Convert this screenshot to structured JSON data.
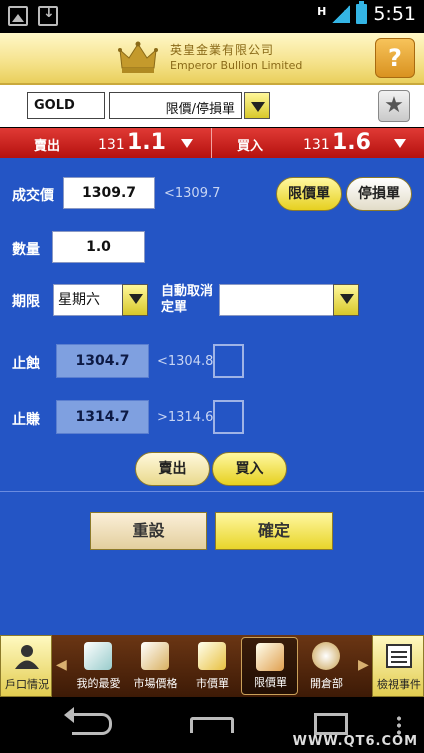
{
  "status_bar": {
    "network": "H",
    "time": "5:51"
  },
  "header": {
    "brand_cn": "英皇金業有限公司",
    "brand_en": "Emperor Bullion Limited",
    "help_label": "?"
  },
  "product": {
    "code": "GOLD",
    "order_type": "限價/停損單"
  },
  "price_bar": {
    "sell_label": "賣出",
    "sell_small": "131",
    "sell_big": "1.1",
    "buy_label": "買入",
    "buy_small": "131",
    "buy_big": "1.6"
  },
  "form": {
    "price_label": "成交價",
    "price_value": "1309.7",
    "price_hint": "<1309.7",
    "limit_btn": "限價單",
    "stop_btn": "停損單",
    "qty_label": "數量",
    "qty_value": "1.0",
    "term_label": "期限",
    "term_value": "星期六",
    "auto_cancel_label_1": "自動取消",
    "auto_cancel_label_2": "定單",
    "auto_cancel_value": "",
    "stoploss_label": "止蝕",
    "stoploss_value": "1304.7",
    "stoploss_hint": "<1304.8",
    "takeprofit_label": "止賺",
    "takeprofit_value": "1314.7",
    "takeprofit_hint": ">1314.6",
    "sell_btn": "賣出",
    "buy_btn": "買入",
    "reset_btn": "重設",
    "confirm_btn": "確定"
  },
  "bottom_nav": {
    "left": "戶口情況",
    "right": "檢視事件",
    "items": [
      {
        "label": "我的最愛"
      },
      {
        "label": "市場價格"
      },
      {
        "label": "市價單"
      },
      {
        "label": "限價單"
      },
      {
        "label": "開倉部"
      }
    ]
  },
  "watermark": "WWW.QT6.COM",
  "colors": {
    "accent_blue": "#2455c5",
    "price_red": "#c41f1b",
    "gold": "#e6d020"
  }
}
